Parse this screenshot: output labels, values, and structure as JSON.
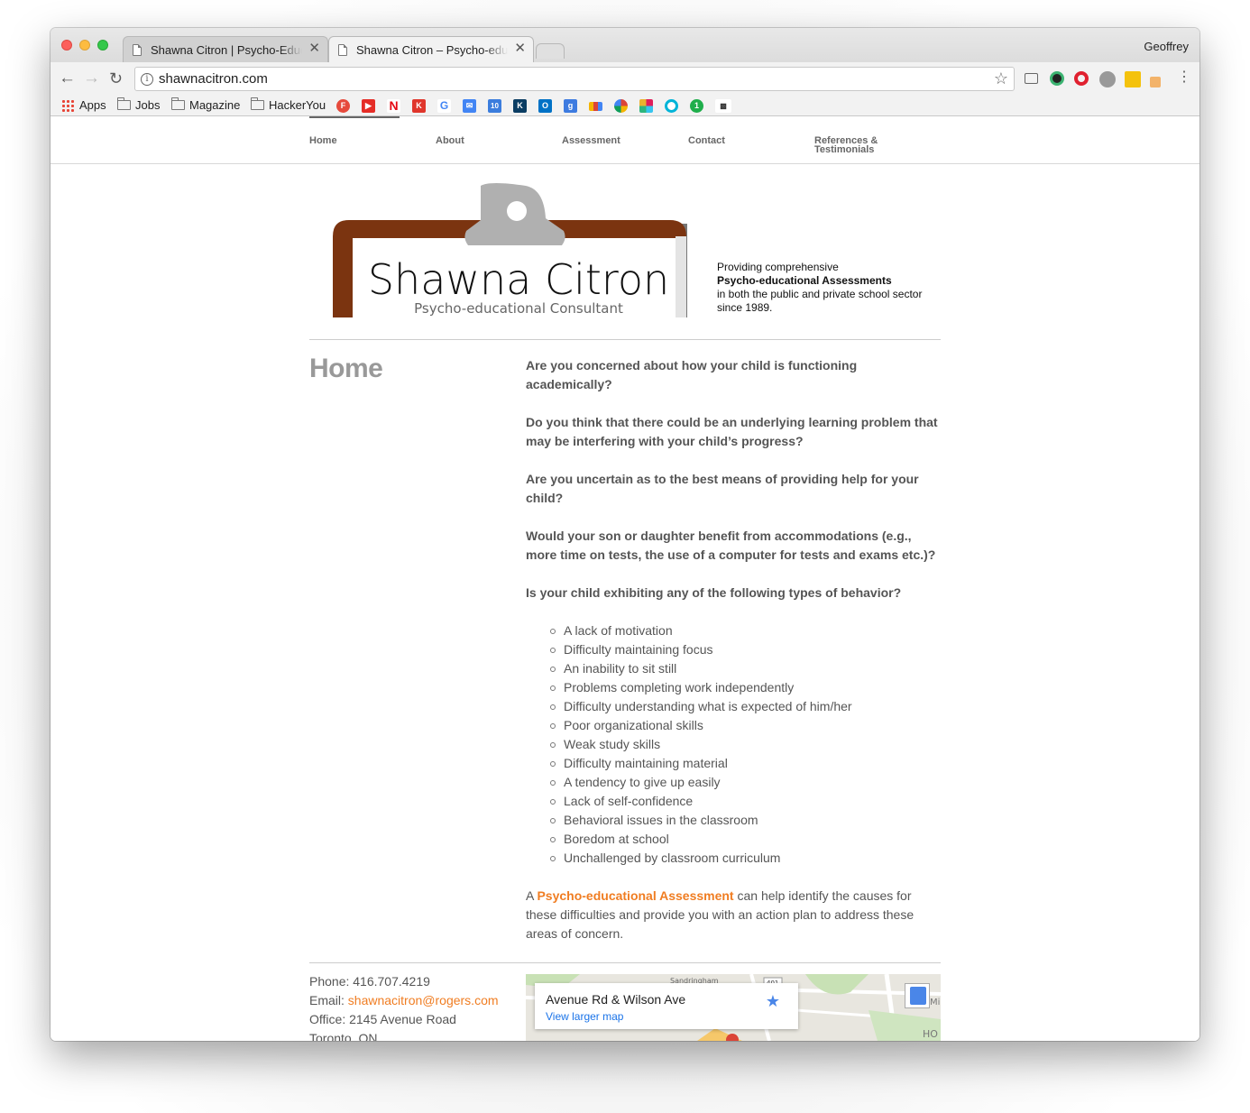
{
  "browser": {
    "tabs": [
      {
        "title": "Shawna Citron | Psycho-Educational Assessments",
        "close": "✕"
      },
      {
        "title": "Shawna Citron – Psycho-educational Consultant",
        "close": "✕"
      }
    ],
    "profile": "Geoffrey",
    "url": "shawnacitron.com",
    "bookmarks": [
      "Apps",
      "Jobs",
      "Magazine",
      "HackerYou"
    ]
  },
  "site": {
    "nav": [
      "Home",
      "About",
      "Assessment",
      "Contact",
      "References &",
      "Testimonials"
    ],
    "logo": {
      "name": "Shawna Citron",
      "subtitle": "Psycho-educational Consultant"
    },
    "tagline": {
      "line1": "Providing comprehensive",
      "line2": "Psycho-educational Assessments",
      "line3": "in both the public and private school sector",
      "line4": "since 1989."
    },
    "heading": "Home",
    "questions": [
      "Are you concerned about how your child is functioning academically?",
      "Do you think that there could be an underlying learning problem that may be interfering with your child’s progress?",
      "Are you uncertain as to the best means of providing help for your child?",
      "Would your son or daughter benefit from accommodations (e.g., more time on tests, the use of a computer for tests and exams etc.)?",
      "Is your child exhibiting any of the following types of behavior?"
    ],
    "behaviors": [
      "A lack of motivation",
      "Difficulty maintaining focus",
      "An inability to sit still",
      "Problems completing work independently",
      "Difficulty understanding what is expected of him/her",
      "Poor organizational skills",
      "Weak study skills",
      "Difficulty maintaining material",
      "A tendency to give up easily",
      "Lack of self-confidence",
      "Behavioral issues in the classroom",
      "Boredom at school",
      "Unchallenged by classroom curriculum"
    ],
    "closing": {
      "prefix": "A ",
      "link": "Psycho-educational Assessment",
      "suffix": " can help identify the causes for these difficulties and provide you with an action plan to address these areas of concern."
    },
    "contact": {
      "phone": "Phone: 416.707.4219",
      "email_label": "Email: ",
      "email": "shawnacitron@rogers.com",
      "office": "Office: 2145 Avenue Road",
      "city": "Toronto, ON"
    },
    "map": {
      "place": "Avenue Rd & Wilson Ave",
      "link": "View larger map",
      "road_label": "401",
      "street_label": "Sandringham",
      "corner_label": "HO",
      "corner_label2": "Mi"
    }
  }
}
